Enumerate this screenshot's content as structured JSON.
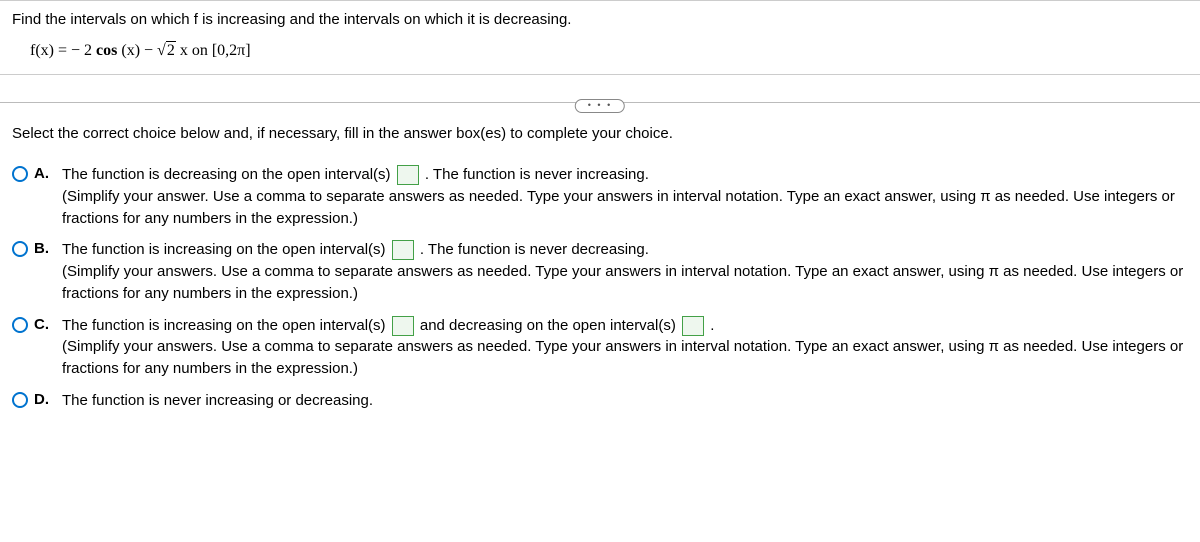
{
  "question": {
    "prompt": "Find the intervals on which f is increasing and the intervals on which it is decreasing.",
    "formula_prefix": "f(x) = − 2 ",
    "formula_cos": "cos",
    "formula_mid": " (x) − ",
    "formula_rad": "2",
    "formula_suffix": " x on [0,2π]"
  },
  "divider_label": "• • •",
  "instruction": "Select the correct choice below and, if necessary, fill in the answer box(es) to complete your choice.",
  "choices": {
    "a": {
      "letter": "A.",
      "line1_pre": "The function is decreasing on the open interval(s) ",
      "line1_post": " . The function is never increasing.",
      "hint": "(Simplify your answer. Use a comma to separate answers as needed. Type your answers in interval notation. Type an exact answer, using π as needed. Use integers or fractions for any numbers in the expression.)"
    },
    "b": {
      "letter": "B.",
      "line1_pre": "The function is increasing on the open interval(s) ",
      "line1_post": " . The function is never decreasing.",
      "hint": "(Simplify your answers. Use a comma to separate answers as needed. Type your answers in interval notation. Type an exact answer, using π as needed. Use integers or fractions for any numbers in the expression.)"
    },
    "c": {
      "letter": "C.",
      "line1_pre": "The function is increasing on the open interval(s) ",
      "line1_mid": " and decreasing on the open interval(s) ",
      "line1_post": " .",
      "hint": "(Simplify your answers. Use a comma to separate answers as needed. Type your answers in interval notation. Type an exact answer, using π as needed. Use integers or fractions for any numbers in the expression.)"
    },
    "d": {
      "letter": "D.",
      "text": "The function is never increasing or decreasing."
    }
  }
}
